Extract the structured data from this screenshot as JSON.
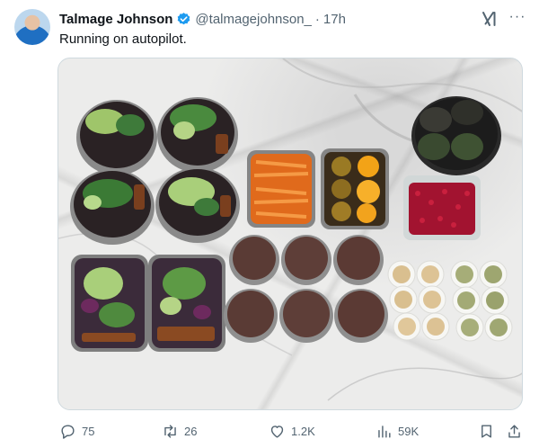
{
  "tweet": {
    "author_name": "Talmage Johnson",
    "handle": "@talmagejohnson_",
    "separator": "·",
    "time": "17h",
    "text": "Running on autopilot."
  },
  "icons": {
    "avatar": "avatar",
    "verified": "verified-badge-icon",
    "grok": "grok-icon",
    "more": "more-icon"
  },
  "actions": {
    "replies": "75",
    "reposts": "26",
    "likes": "1.2K",
    "views": "59K"
  },
  "colors": {
    "text_primary": "#0f1419",
    "text_secondary": "#536471",
    "verified_blue": "#1d9bf0",
    "border": "#cfd9de"
  }
}
